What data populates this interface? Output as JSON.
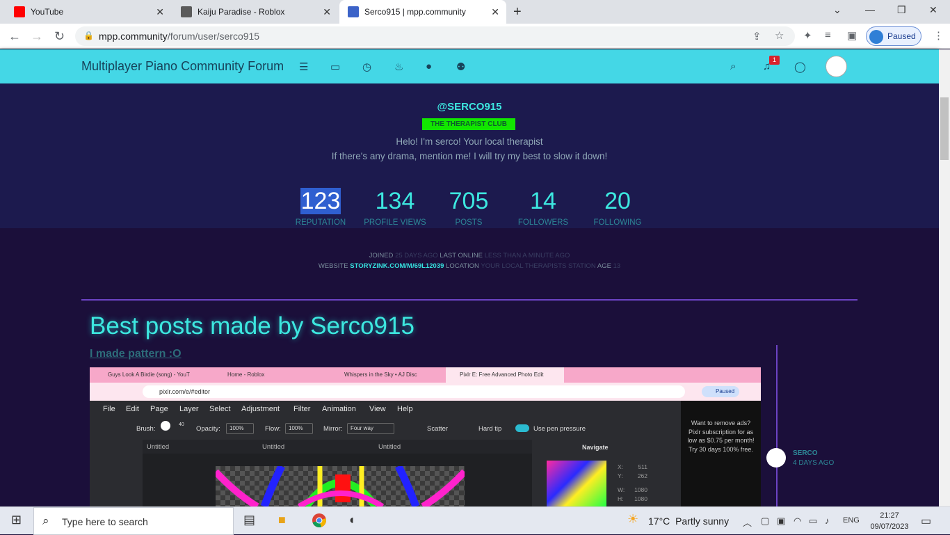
{
  "browser": {
    "tabs": [
      {
        "title": "YouTube",
        "color": "#ff0000",
        "active": false
      },
      {
        "title": "Kaiju Paradise - Roblox",
        "color": "#5a5a5a",
        "active": false
      },
      {
        "title": "Serco915 | mpp.community",
        "color": "#3c63c8",
        "active": true
      }
    ],
    "url_host": "mpp.community",
    "url_path": "/forum/user/serco915",
    "profile_status": "Paused"
  },
  "forum": {
    "brand": "Multiplayer Piano Community Forum",
    "notification_count": "1",
    "nav_icons": [
      "list-icon",
      "inbox-icon",
      "clock-icon",
      "fire-icon",
      "user-icon",
      "group-icon"
    ]
  },
  "profile": {
    "handle": "@SERCO915",
    "group_badge": "THE THERAPIST CLUB",
    "bio_line1": "Helo! I'm serco! Your local therapist",
    "bio_line2": "If there's any drama, mention me! I will try my best to slow it down!",
    "stats": [
      {
        "value": "123",
        "label": "REPUTATION"
      },
      {
        "value": "134",
        "label": "PROFILE VIEWS"
      },
      {
        "value": "705",
        "label": "POSTS"
      },
      {
        "value": "14",
        "label": "FOLLOWERS"
      },
      {
        "value": "20",
        "label": "FOLLOWING"
      }
    ],
    "meta": {
      "joined_label": "JOINED",
      "joined_value": "25 DAYS AGO",
      "online_label": "LAST ONLINE",
      "online_value": "LESS THAN A MINUTE AGO",
      "website_label": "WEBSITE",
      "website_value": "STORYZINK.COM/M/69L12039",
      "location_label": "LOCATION",
      "location_value": "YOUR LOCAL THERAPISTS STATION",
      "age_label": "AGE",
      "age_value": "13"
    }
  },
  "best_posts": {
    "title": "Best posts made by Serco915",
    "post_title": "I made pattern :O",
    "author": "SERCO",
    "time": "4 DAYS AGO"
  },
  "embedded_screenshot": {
    "tabs": [
      "Guys Look A Birdie (song) - YouT",
      "Home - Roblox",
      "Whispers in the Sky • AJ Disc",
      "Pixlr E: Free Advanced Photo Edit"
    ],
    "url": "pixlr.com/e/#editor",
    "paused": "Paused",
    "menu": [
      "File",
      "Edit",
      "Page",
      "Layer",
      "Select",
      "Adjustment",
      "Filter",
      "Animation",
      "View",
      "Help"
    ],
    "options": {
      "brush": "Brush:",
      "brush_size": "40",
      "opacity_label": "Opacity:",
      "opacity": "100%",
      "flow_label": "Flow:",
      "flow": "100%",
      "mirror_label": "Mirror:",
      "mirror": "Four way",
      "scatter": "Scatter",
      "hard_tip": "Hard tip",
      "pen_pressure": "Use pen pressure"
    },
    "doc_tabs": [
      "Untitled",
      "Untitled",
      "Untitled"
    ],
    "navigate": "Navigate",
    "x_label": "X:",
    "x_value": "511",
    "y_label": "Y:",
    "y_value": "262",
    "w_label": "W:",
    "w_value": "1080",
    "h_label": "H:",
    "h_value": "1080",
    "ad_text": "Want to remove ads? Pixlr subscription for as low as $0.75 per month!",
    "ad_text2": "Try 30 days 100% free."
  },
  "taskbar": {
    "search_placeholder": "Type here to search",
    "temperature": "17°C",
    "weather": "Partly sunny",
    "lang": "ENG",
    "time": "21:27",
    "date": "09/07/2023"
  }
}
